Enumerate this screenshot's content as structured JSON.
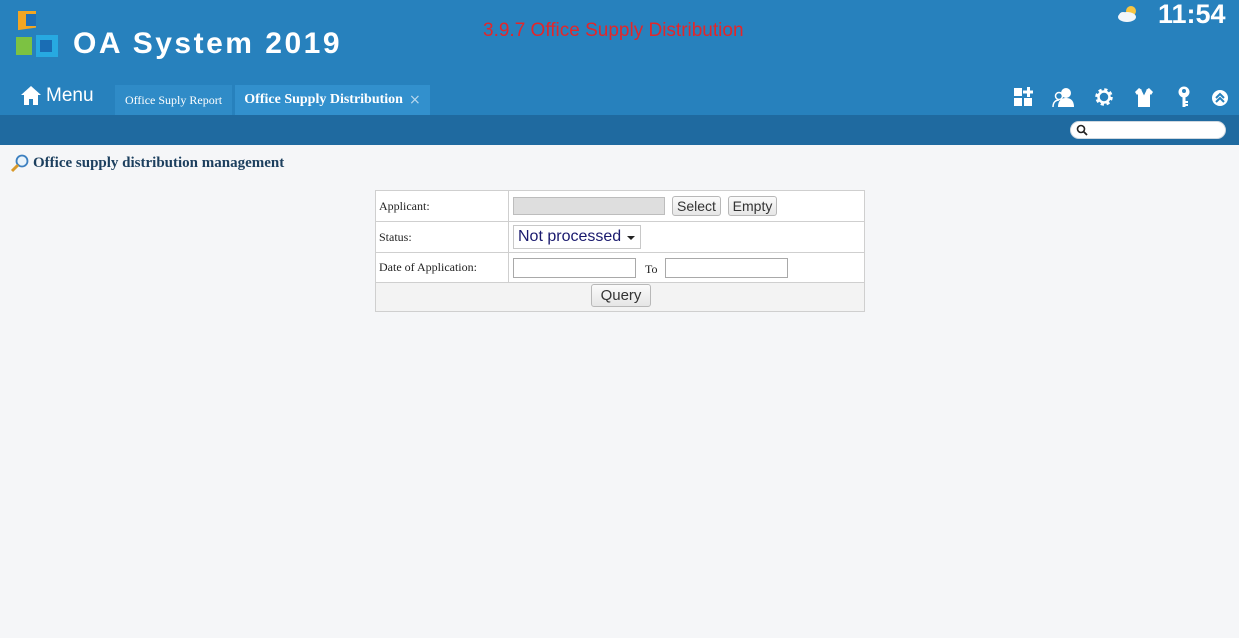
{
  "header": {
    "app_title": "OA System 2019",
    "page_caption": "3.9.7 Office Supply Distribution",
    "clock": "11:54",
    "menu_label": "Menu",
    "colors": {
      "header_bg": "#2781bd",
      "subbar_bg": "#1f6aa0",
      "caption": "#e3262a"
    }
  },
  "tabs": [
    {
      "label": "Office Suply Report",
      "active": false
    },
    {
      "label": "Office Supply Distribution",
      "active": true,
      "close_icon": "×"
    }
  ],
  "toolbar": {
    "icons": [
      "dashboard-add-icon",
      "users-icon",
      "settings-gear-icon",
      "shirt-icon",
      "key-icon",
      "collapse-up-icon"
    ]
  },
  "search": {
    "placeholder": ""
  },
  "section": {
    "title": "Office supply distribution management",
    "icon": "magnifier-icon"
  },
  "form": {
    "applicant_label": "Applicant:",
    "applicant_value": "",
    "select_button": "Select",
    "empty_button": "Empty",
    "status_label": "Status:",
    "status_value": "Not processed",
    "date_label": "Date of Application:",
    "date_from": "",
    "to_label": "To",
    "date_to": "",
    "query_button": "Query"
  }
}
